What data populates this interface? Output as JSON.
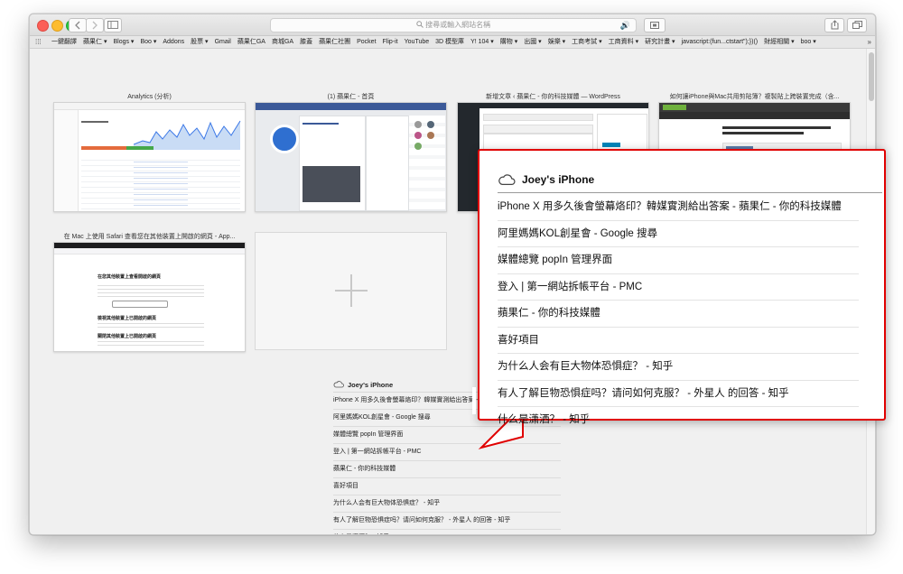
{
  "toolbar": {
    "back_icon": "chevron-left-icon",
    "forward_icon": "chevron-right-icon",
    "address_placeholder": "搜尋或輸入網站名稱",
    "search_icon": "magnifier-icon",
    "sound_icon": "speaker-icon"
  },
  "bookmarks": [
    "一鍵翻譯",
    "蘋果仁 ▾",
    "Blogs ▾",
    "Boo ▾",
    "Addons",
    "股票 ▾",
    "Gmail",
    "蘋果仁GA",
    "商城GA",
    "膝蓋",
    "蘋果仁社團",
    "Pocket",
    "Flip-it",
    "YouTube",
    "3D 模型庫",
    "Y! 104 ▾",
    "購物 ▾",
    "出國 ▾",
    "娛樂 ▾",
    "工商考試 ▾",
    "工商資料 ▾",
    "研究計畫 ▾",
    "javascript:(fun...ctstart\");})()",
    "財經相關 ▾",
    "boo ▾"
  ],
  "favorites": [
    {
      "title": "Analytics (分析)"
    },
    {
      "title": "(1) 蘋果仁 - 首頁"
    },
    {
      "title": "新增文章 ‹ 蘋果仁 - 你的科技媒體 — WordPress"
    },
    {
      "title": "如何讓iPhone與Mac共用剪貼簿？複製貼上跨裝置完成（含..."
    },
    {
      "title": "在 Mac 上使用 Safari 查看您在其他裝置上開啟的網頁 - App..."
    }
  ],
  "thumb_text": {
    "fav5_heading": "在您其他裝置上查看開啟的網頁",
    "fav5_sub1": "檢視其他裝置上已開啟的網頁",
    "fav5_sub2": "關閉其他裝置上已開啟的網頁",
    "fav2_promo": "蘋果仁"
  },
  "cloud_tabs": {
    "device": "Joey's iPhone",
    "items": [
      "iPhone X 用多久後會螢幕烙印？韓媒實測給出答案 - 蘋果仁 - 你的科技媒體",
      "阿里媽媽KOL創星會 - Google 搜尋",
      "媒體總覽 popIn 管理界面",
      "登入 | 第一網站拆帳平台 - PMC",
      "蘋果仁 - 你的科技媒體",
      "喜好項目",
      "为什么人会有巨大物体恐惧症？ - 知乎",
      "有人了解巨物恐惧症吗？请问如何克服？ - 外星人 的回答 - 知乎",
      "什么是潇洒？ - 知乎",
      "大学教授的生活是什么样的呢？ - 知乎"
    ]
  },
  "colors": {
    "callout_border": "#e00000",
    "accent_blue": "#2a7de1",
    "wp_dark": "#23282d"
  }
}
